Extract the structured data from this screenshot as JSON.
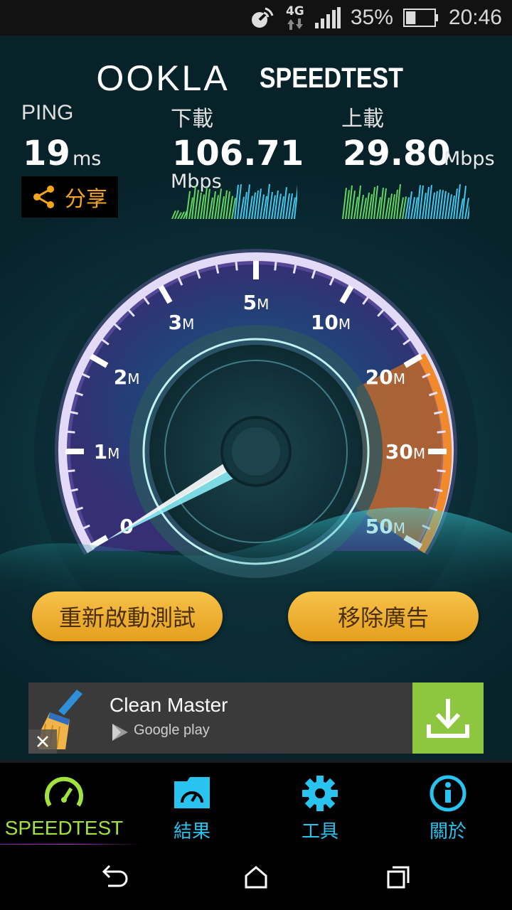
{
  "status_bar": {
    "network_type": "4G",
    "battery_percent": "35%",
    "battery_level": 0.35,
    "time": "20:46",
    "icons": [
      "nfc-icon",
      "data-arrows-icon",
      "signal-icon",
      "battery-icon"
    ]
  },
  "header": {
    "brand": "OOKLA",
    "product": "SPEEDTEST"
  },
  "metrics": {
    "ping": {
      "label": "PING",
      "value": "19",
      "unit": "ms"
    },
    "download": {
      "label": "下載",
      "value": "106.71",
      "unit": "Mbps"
    },
    "upload": {
      "label": "上載",
      "value": "29.80",
      "unit": "Mbps"
    }
  },
  "share": {
    "label": "分享",
    "icon": "share-icon"
  },
  "gauge": {
    "ticks": [
      {
        "num": "0",
        "unit": ""
      },
      {
        "num": "1",
        "unit": "M"
      },
      {
        "num": "2",
        "unit": "M"
      },
      {
        "num": "3",
        "unit": "M"
      },
      {
        "num": "5",
        "unit": "M"
      },
      {
        "num": "10",
        "unit": "M"
      },
      {
        "num": "20",
        "unit": "M"
      },
      {
        "num": "30",
        "unit": "M"
      },
      {
        "num": "50",
        "unit": "M"
      }
    ],
    "needle_value": "0",
    "accent_color": "#f08a2c",
    "arc_color": "#c9a8ff"
  },
  "buttons": {
    "restart": "重新啟動測試",
    "remove_ads": "移除廣告"
  },
  "ad": {
    "title": "Clean Master",
    "store": "Google play",
    "download_icon": "download-icon",
    "close_icon": "close-icon"
  },
  "bottom_nav": {
    "items": [
      {
        "label": "SPEEDTEST",
        "icon": "speedometer-icon",
        "active": true
      },
      {
        "label": "結果",
        "icon": "results-folder-icon"
      },
      {
        "label": "工具",
        "icon": "gear-icon"
      },
      {
        "label": "關於",
        "icon": "info-icon"
      }
    ]
  },
  "system_nav": {
    "back": "back-icon",
    "home": "home-icon",
    "recents": "recents-icon"
  },
  "colors": {
    "accent_orange": "#f5a51a",
    "nav_blue": "#29c3f0",
    "nav_green": "#a3e23a",
    "ad_green": "#8dc63f"
  }
}
